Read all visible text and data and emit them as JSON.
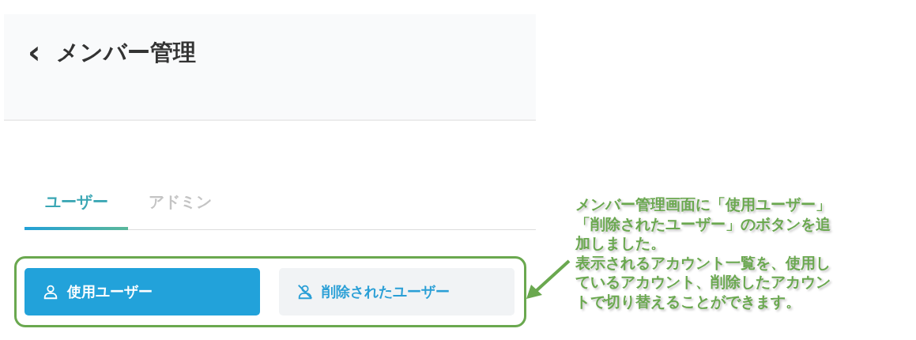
{
  "header": {
    "back": "‹",
    "title": "メンバー管理"
  },
  "tabs": [
    {
      "label": "ユーザー",
      "selected": true
    },
    {
      "label": "アドミン",
      "selected": false
    }
  ],
  "filter_buttons": [
    {
      "label": "使用ユーザー",
      "selected": true,
      "kind": "active-users"
    },
    {
      "label": "削除されたユーザー",
      "selected": false,
      "kind": "deleted-users"
    }
  ],
  "annotation": {
    "lines": [
      "メンバー管理画面に「使用ユーザー」",
      "「削除されたユーザー」のボタンを追",
      "加しました。",
      "表示されるアカウント一覧を、使用し",
      "ているアカウント、削除したアカウン",
      "トで切り替えることができます。"
    ]
  }
}
